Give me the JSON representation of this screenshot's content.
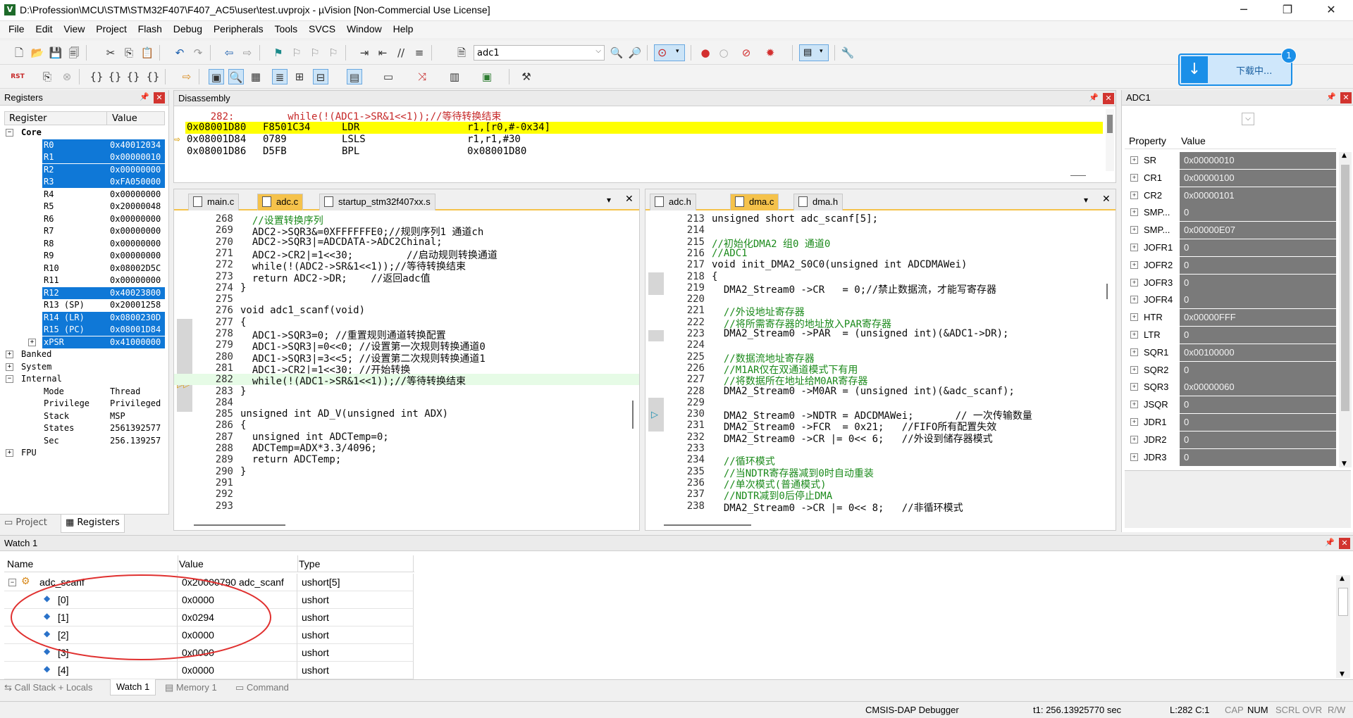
{
  "window": {
    "title": "D:\\Profession\\MCU\\STM\\STM32F407\\F407_AC5\\user\\test.uvprojx - µVision  [Non-Commercial Use License]",
    "logo": "V",
    "minimize": "─",
    "maximize": "❐",
    "close": "✕"
  },
  "menu": [
    "File",
    "Edit",
    "View",
    "Project",
    "Flash",
    "Debug",
    "Peripherals",
    "Tools",
    "SVCS",
    "Window",
    "Help"
  ],
  "toolbar": {
    "target_value": "adc1"
  },
  "download_popup": {
    "label": "下载中...",
    "badge": "1"
  },
  "registers": {
    "title": "Registers",
    "col_register": "Register",
    "col_value": "Value",
    "rows": [
      {
        "n": "Core",
        "v": "",
        "exp": "−",
        "ind": 0,
        "sel": false,
        "bold": true
      },
      {
        "n": "R0",
        "v": "0x40012034",
        "ind": 2,
        "sel": true
      },
      {
        "n": "R1",
        "v": "0x00000010",
        "ind": 2,
        "sel": true
      },
      {
        "n": "R2",
        "v": "0x00000000",
        "ind": 2,
        "sel": true
      },
      {
        "n": "R3",
        "v": "0xFA050000",
        "ind": 2,
        "sel": true
      },
      {
        "n": "R4",
        "v": "0x00000000",
        "ind": 2,
        "sel": false
      },
      {
        "n": "R5",
        "v": "0x20000048",
        "ind": 2,
        "sel": false
      },
      {
        "n": "R6",
        "v": "0x00000000",
        "ind": 2,
        "sel": false
      },
      {
        "n": "R7",
        "v": "0x00000000",
        "ind": 2,
        "sel": false
      },
      {
        "n": "R8",
        "v": "0x00000000",
        "ind": 2,
        "sel": false
      },
      {
        "n": "R9",
        "v": "0x00000000",
        "ind": 2,
        "sel": false
      },
      {
        "n": "R10",
        "v": "0x08002D5C",
        "ind": 2,
        "sel": false
      },
      {
        "n": "R11",
        "v": "0x00000000",
        "ind": 2,
        "sel": false
      },
      {
        "n": "R12",
        "v": "0x40023800",
        "ind": 2,
        "sel": true
      },
      {
        "n": "R13 (SP)",
        "v": "0x20001258",
        "ind": 2,
        "sel": false
      },
      {
        "n": "R14 (LR)",
        "v": "0x0800230D",
        "ind": 2,
        "sel": true
      },
      {
        "n": "R15 (PC)",
        "v": "0x08001D84",
        "ind": 2,
        "sel": true
      },
      {
        "n": "xPSR",
        "v": "0x41000000",
        "exp": "+",
        "ind": 2,
        "sel": true
      },
      {
        "n": "Banked",
        "v": "",
        "exp": "+",
        "ind": 0,
        "sel": false
      },
      {
        "n": "System",
        "v": "",
        "exp": "+",
        "ind": 0,
        "sel": false
      },
      {
        "n": "Internal",
        "v": "",
        "exp": "−",
        "ind": 0,
        "sel": false
      },
      {
        "n": "Mode",
        "v": "Thread",
        "ind": 2,
        "sel": false
      },
      {
        "n": "Privilege",
        "v": "Privileged",
        "ind": 2,
        "sel": false
      },
      {
        "n": "Stack",
        "v": "MSP",
        "ind": 2,
        "sel": false
      },
      {
        "n": "States",
        "v": "2561392577",
        "ind": 2,
        "sel": false
      },
      {
        "n": "Sec",
        "v": "256.139257",
        "ind": 2,
        "sel": false
      },
      {
        "n": "FPU",
        "v": "",
        "exp": "+",
        "ind": 0,
        "sel": false
      }
    ],
    "tab_project": "Project",
    "tab_registers": "Registers"
  },
  "disassembly": {
    "title": "Disassembly",
    "src_line": "    282:         while(!(ADC1->SR&1<<1));//等待转换结束",
    "lines": [
      {
        "addr": "0x08001D80",
        "hex": "F8501C34",
        "op": "LDR",
        "args": "r1,[r0,#-0x34]",
        "hl": true
      },
      {
        "addr": "0x08001D84",
        "hex": "0789",
        "op": "LSLS",
        "args": "r1,r1,#30",
        "hl": false
      },
      {
        "addr": "0x08001D86",
        "hex": "D5FB",
        "op": "BPL",
        "args": "0x08001D80",
        "hl": false
      }
    ]
  },
  "editor1": {
    "tabs": [
      "main.c",
      "adc.c",
      "startup_stm32f407xx.s"
    ],
    "active": 1,
    "lines": [
      {
        "ln": "268",
        "t": "  //设置转换序列",
        "c": "cm"
      },
      {
        "ln": "269",
        "t": "  ADC2->SQR3&=0XFFFFFFE0;//规则序列1 通道ch",
        "c": ""
      },
      {
        "ln": "270",
        "t": "  ADC2->SQR3|=ADCDATA->ADC2Chinal;",
        "c": ""
      },
      {
        "ln": "271",
        "t": "  ADC2->CR2|=1<<30;         //启动规则转换通道",
        "c": ""
      },
      {
        "ln": "272",
        "t": "  while(!(ADC2->SR&1<<1));//等待转换结束",
        "c": ""
      },
      {
        "ln": "273",
        "t": "  return ADC2->DR;    //返回adc值",
        "c": ""
      },
      {
        "ln": "274",
        "t": "}",
        "c": ""
      },
      {
        "ln": "275",
        "t": "",
        "c": ""
      },
      {
        "ln": "276",
        "t": "void adc1_scanf(void)",
        "c": ""
      },
      {
        "ln": "277",
        "t": "{",
        "c": ""
      },
      {
        "ln": "278",
        "t": "  ADC1->SQR3=0; //重置规则通道转换配置",
        "c": ""
      },
      {
        "ln": "279",
        "t": "  ADC1->SQR3|=0<<0; //设置第一次规则转换通道0",
        "c": ""
      },
      {
        "ln": "280",
        "t": "  ADC1->SQR3|=3<<5; //设置第二次规则转换通道1",
        "c": ""
      },
      {
        "ln": "281",
        "t": "  ADC1->CR2|=1<<30; //开始转换",
        "c": ""
      },
      {
        "ln": "282",
        "t": "  while(!(ADC1->SR&1<<1));//等待转换结束",
        "c": "cur"
      },
      {
        "ln": "283",
        "t": "}",
        "c": ""
      },
      {
        "ln": "284",
        "t": "",
        "c": ""
      },
      {
        "ln": "285",
        "t": "unsigned int AD_V(unsigned int ADX)",
        "c": ""
      },
      {
        "ln": "286",
        "t": "{",
        "c": ""
      },
      {
        "ln": "287",
        "t": "  unsigned int ADCTemp=0;",
        "c": ""
      },
      {
        "ln": "288",
        "t": "  ADCTemp=ADX*3.3/4096;",
        "c": ""
      },
      {
        "ln": "289",
        "t": "  return ADCTemp;",
        "c": ""
      },
      {
        "ln": "290",
        "t": "}",
        "c": ""
      },
      {
        "ln": "291",
        "t": "",
        "c": ""
      },
      {
        "ln": "292",
        "t": "",
        "c": ""
      },
      {
        "ln": "293",
        "t": "",
        "c": ""
      }
    ]
  },
  "editor2": {
    "tabs": [
      "adc.h",
      "dma.c",
      "dma.h"
    ],
    "active": 1,
    "lines": [
      {
        "ln": "213",
        "t": "unsigned short adc_scanf[5];",
        "c": ""
      },
      {
        "ln": "214",
        "t": "",
        "c": ""
      },
      {
        "ln": "215",
        "t": "//初始化DMA2 组0 通道0",
        "c": "cm"
      },
      {
        "ln": "216",
        "t": "//ADC1",
        "c": "cm"
      },
      {
        "ln": "217",
        "t": "void init_DMA2_S0C0(unsigned int ADCDMAWei)",
        "c": ""
      },
      {
        "ln": "218",
        "t": "{",
        "c": ""
      },
      {
        "ln": "219",
        "t": "  DMA2_Stream0 ->CR   = 0;//禁止数据流，才能写寄存器",
        "c": ""
      },
      {
        "ln": "220",
        "t": "",
        "c": ""
      },
      {
        "ln": "221",
        "t": "  //外设地址寄存器",
        "c": "cm"
      },
      {
        "ln": "222",
        "t": "  //将所需寄存器的地址放入PAR寄存器",
        "c": "cm"
      },
      {
        "ln": "223",
        "t": "  DMA2_Stream0 ->PAR  = (unsigned int)(&ADC1->DR);",
        "c": ""
      },
      {
        "ln": "224",
        "t": "",
        "c": ""
      },
      {
        "ln": "225",
        "t": "  //数据流地址寄存器",
        "c": "cm"
      },
      {
        "ln": "226",
        "t": "  //M1AR仅在双通道模式下有用",
        "c": "cm"
      },
      {
        "ln": "227",
        "t": "  //将数据所在地址给M0AR寄存器",
        "c": "cm"
      },
      {
        "ln": "228",
        "t": "  DMA2_Stream0 ->M0AR = (unsigned int)(&adc_scanf);",
        "c": ""
      },
      {
        "ln": "229",
        "t": "",
        "c": ""
      },
      {
        "ln": "230",
        "t": "  DMA2_Stream0 ->NDTR = ADCDMAWei;       // 一次传输数量",
        "c": ""
      },
      {
        "ln": "231",
        "t": "  DMA2_Stream0 ->FCR  = 0x21;   //FIFO所有配置失效",
        "c": ""
      },
      {
        "ln": "232",
        "t": "  DMA2_Stream0 ->CR |= 0<< 6;   //外设到储存器模式",
        "c": ""
      },
      {
        "ln": "233",
        "t": "",
        "c": ""
      },
      {
        "ln": "234",
        "t": "  //循环模式",
        "c": "cm"
      },
      {
        "ln": "235",
        "t": "  //当NDTR寄存器减到0时自动重装",
        "c": "cm"
      },
      {
        "ln": "236",
        "t": "  //单次模式(普通模式)",
        "c": "cm"
      },
      {
        "ln": "237",
        "t": "  //NDTR减到0后停止DMA",
        "c": "cm"
      },
      {
        "ln": "238",
        "t": "  DMA2_Stream0 ->CR |= 0<< 8;   //非循环模式",
        "c": ""
      }
    ]
  },
  "adc1": {
    "title": "ADC1",
    "col_property": "Property",
    "col_value": "Value",
    "rows": [
      {
        "n": "SR",
        "v": "0x00000010"
      },
      {
        "n": "CR1",
        "v": "0x00000100"
      },
      {
        "n": "CR2",
        "v": "0x00000101"
      },
      {
        "n": "SMP...",
        "v": "0"
      },
      {
        "n": "SMP...",
        "v": "0x00000E07"
      },
      {
        "n": "JOFR1",
        "v": "0"
      },
      {
        "n": "JOFR2",
        "v": "0"
      },
      {
        "n": "JOFR3",
        "v": "0"
      },
      {
        "n": "JOFR4",
        "v": "0"
      },
      {
        "n": "HTR",
        "v": "0x00000FFF"
      },
      {
        "n": "LTR",
        "v": "0"
      },
      {
        "n": "SQR1",
        "v": "0x00100000"
      },
      {
        "n": "SQR2",
        "v": "0"
      },
      {
        "n": "SQR3",
        "v": "0x00000060"
      },
      {
        "n": "JSQR",
        "v": "0"
      },
      {
        "n": "JDR1",
        "v": "0"
      },
      {
        "n": "JDR2",
        "v": "0"
      },
      {
        "n": "JDR3",
        "v": "0"
      }
    ]
  },
  "watch": {
    "title": "Watch 1",
    "col_name": "Name",
    "col_value": "Value",
    "col_type": "Type",
    "rows": [
      {
        "name": "adc_scanf",
        "value": "0x20000790 adc_scanf",
        "type": "ushort[5]",
        "lvl": 0
      },
      {
        "name": "[0]",
        "value": "0x0000",
        "type": "ushort",
        "lvl": 1
      },
      {
        "name": "[1]",
        "value": "0x0294",
        "type": "ushort",
        "lvl": 1
      },
      {
        "name": "[2]",
        "value": "0x0000",
        "type": "ushort",
        "lvl": 1
      },
      {
        "name": "[3]",
        "value": "0x0000",
        "type": "ushort",
        "lvl": 1
      },
      {
        "name": "[4]",
        "value": "0x0000",
        "type": "ushort",
        "lvl": 1
      }
    ],
    "tabs": [
      "Call Stack + Locals",
      "Watch 1",
      "Memory 1",
      "Command"
    ]
  },
  "status": {
    "debugger": "CMSIS-DAP Debugger",
    "time": "t1: 256.13925770 sec",
    "pos": "L:282 C:1",
    "caps": "CAP",
    "num": "NUM",
    "scrl": "SCRL",
    "ovr": "OVR",
    "rw": "R/W"
  }
}
